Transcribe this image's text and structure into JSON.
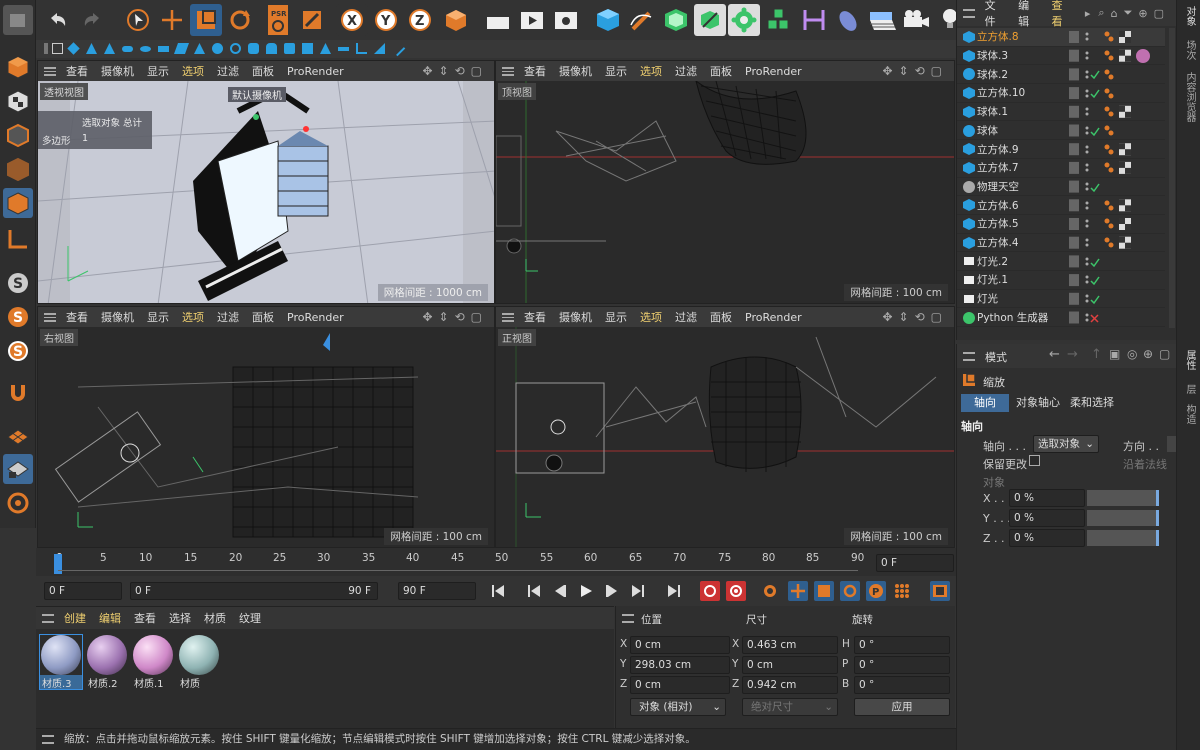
{
  "toolbar": {
    "psr_label": "PSR",
    "x": "X",
    "y": "Y",
    "z": "Z"
  },
  "viewports": [
    {
      "menu": [
        "查看",
        "摄像机",
        "显示",
        "选项",
        "过滤",
        "面板",
        "ProRender"
      ],
      "label": "透视视图",
      "camera": "默认摄像机",
      "info_header": "选取对象  总计",
      "info_row_label": "多边形",
      "info_row_value": "1",
      "grid": "网格间距 : 1000 cm"
    },
    {
      "menu": [
        "查看",
        "摄像机",
        "显示",
        "选项",
        "过滤",
        "面板",
        "ProRender"
      ],
      "label": "顶视图",
      "grid": "网格间距 : 100 cm"
    },
    {
      "menu": [
        "查看",
        "摄像机",
        "显示",
        "选项",
        "过滤",
        "面板",
        "ProRender"
      ],
      "label": "右视图",
      "grid": "网格间距 : 100 cm"
    },
    {
      "menu": [
        "查看",
        "摄像机",
        "显示",
        "选项",
        "过滤",
        "面板",
        "ProRender"
      ],
      "label": "正视图",
      "grid": "网格间距 : 100 cm"
    }
  ],
  "axis_labels": {
    "x": "X",
    "y": "Y",
    "z": "Z"
  },
  "timeline": {
    "ticks": [
      "0",
      "5",
      "10",
      "15",
      "20",
      "25",
      "30",
      "35",
      "40",
      "45",
      "50",
      "55",
      "60",
      "65",
      "70",
      "75",
      "80",
      "85",
      "90"
    ],
    "current_frame": "0 F"
  },
  "transport": {
    "start": "0 F",
    "range_start": "0 F",
    "range_end": "90 F",
    "end": "90 F"
  },
  "material_manager": {
    "menu": [
      "创建",
      "编辑",
      "查看",
      "选择",
      "材质",
      "纹理"
    ],
    "materials": [
      {
        "name": "材质.3",
        "color": "#8f9bc4"
      },
      {
        "name": "材质.2",
        "color": "#9c72b0"
      },
      {
        "name": "材质.1",
        "color": "#cf88c8"
      },
      {
        "name": "材质",
        "color": "#8fb3b3"
      }
    ]
  },
  "coordinates": {
    "headers": [
      "位置",
      "尺寸",
      "旋转"
    ],
    "rows": [
      {
        "axis": "X",
        "pos": "0 cm",
        "size_axis": "X",
        "size": "0.463 cm",
        "rot_axis": "H",
        "rot": "0 °"
      },
      {
        "axis": "Y",
        "pos": "298.03 cm",
        "size_axis": "Y",
        "size": "0 cm",
        "rot_axis": "P",
        "rot": "0 °"
      },
      {
        "axis": "Z",
        "pos": "0 cm",
        "size_axis": "Z",
        "size": "0.942 cm",
        "rot_axis": "B",
        "rot": "0 °"
      }
    ],
    "mode": "对象 (相对)",
    "size_mode": "绝对尺寸",
    "apply": "应用"
  },
  "status": "缩放：点击并拖动鼠标缩放元素。按住 SHIFT 键量化缩放；节点编辑模式时按住 SHIFT 键增加选择对象；按住 CTRL 键减少选择对象。",
  "object_manager": {
    "menu": [
      "文件",
      "编辑",
      "查看"
    ],
    "objects": [
      {
        "name": "立方体.8",
        "selected": true
      },
      {
        "name": "球体.3"
      },
      {
        "name": "球体.2"
      },
      {
        "name": "立方体.10"
      },
      {
        "name": "球体.1"
      },
      {
        "name": "球体"
      },
      {
        "name": "立方体.9"
      },
      {
        "name": "立方体.7"
      },
      {
        "name": "物理天空"
      },
      {
        "name": "立方体.6"
      },
      {
        "name": "立方体.5"
      },
      {
        "name": "立方体.4"
      },
      {
        "name": "灯光.2"
      },
      {
        "name": "灯光.1"
      },
      {
        "name": "灯光"
      },
      {
        "name": "Python 生成器"
      }
    ]
  },
  "attributes": {
    "menu": "模式",
    "tool": "缩放",
    "tabs": [
      "轴向",
      "对象轴心",
      "柔和选择"
    ],
    "section": "轴向",
    "axis_label": "轴向 . . .",
    "axis_value": "选取对象",
    "direction_label": "方向 . .",
    "keep_changes": "保留更改",
    "along_normal": "沿着法线",
    "object_label": "对象",
    "xyz": [
      {
        "axis": "X . . .",
        "val": "0 %"
      },
      {
        "axis": "Y . . .",
        "val": "0 %"
      },
      {
        "axis": "Z . . .",
        "val": "0 %"
      }
    ]
  },
  "side_tabs": [
    "对象",
    "场次",
    "内容浏览器",
    "属性",
    "层",
    "构造"
  ]
}
